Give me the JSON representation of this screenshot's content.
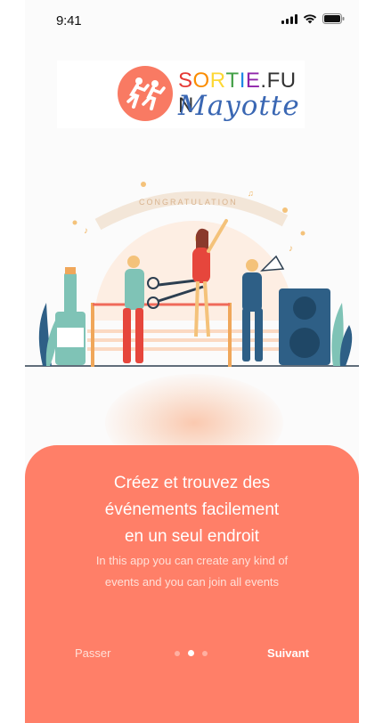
{
  "status_bar": {
    "time": "9:41"
  },
  "logo": {
    "line1": [
      "S",
      "O",
      "R",
      "T",
      "I",
      "E",
      ".",
      "F",
      "U",
      "N"
    ],
    "line1_colors": [
      "#e53935",
      "#fb8c00",
      "#fdd835",
      "#43a047",
      "#1e88e5",
      "#8e24aa",
      "#333333",
      "#333333",
      "#333333",
      "#333333"
    ],
    "line2": "Mayotte"
  },
  "illustration": {
    "banner_text": "CONGRATULATION"
  },
  "card": {
    "title_lines": [
      "Créez et trouvez des",
      "événements facilement",
      "en un seul endroit"
    ],
    "description_lines": [
      "In this app you can create any kind of",
      "events and you can join all events"
    ],
    "skip_label": "Passer",
    "next_label": "Suivant",
    "page_indicator": {
      "total": 3,
      "active": 2
    }
  },
  "colors": {
    "accent": "#ff7f68",
    "logo_blue": "#3a67b3"
  }
}
